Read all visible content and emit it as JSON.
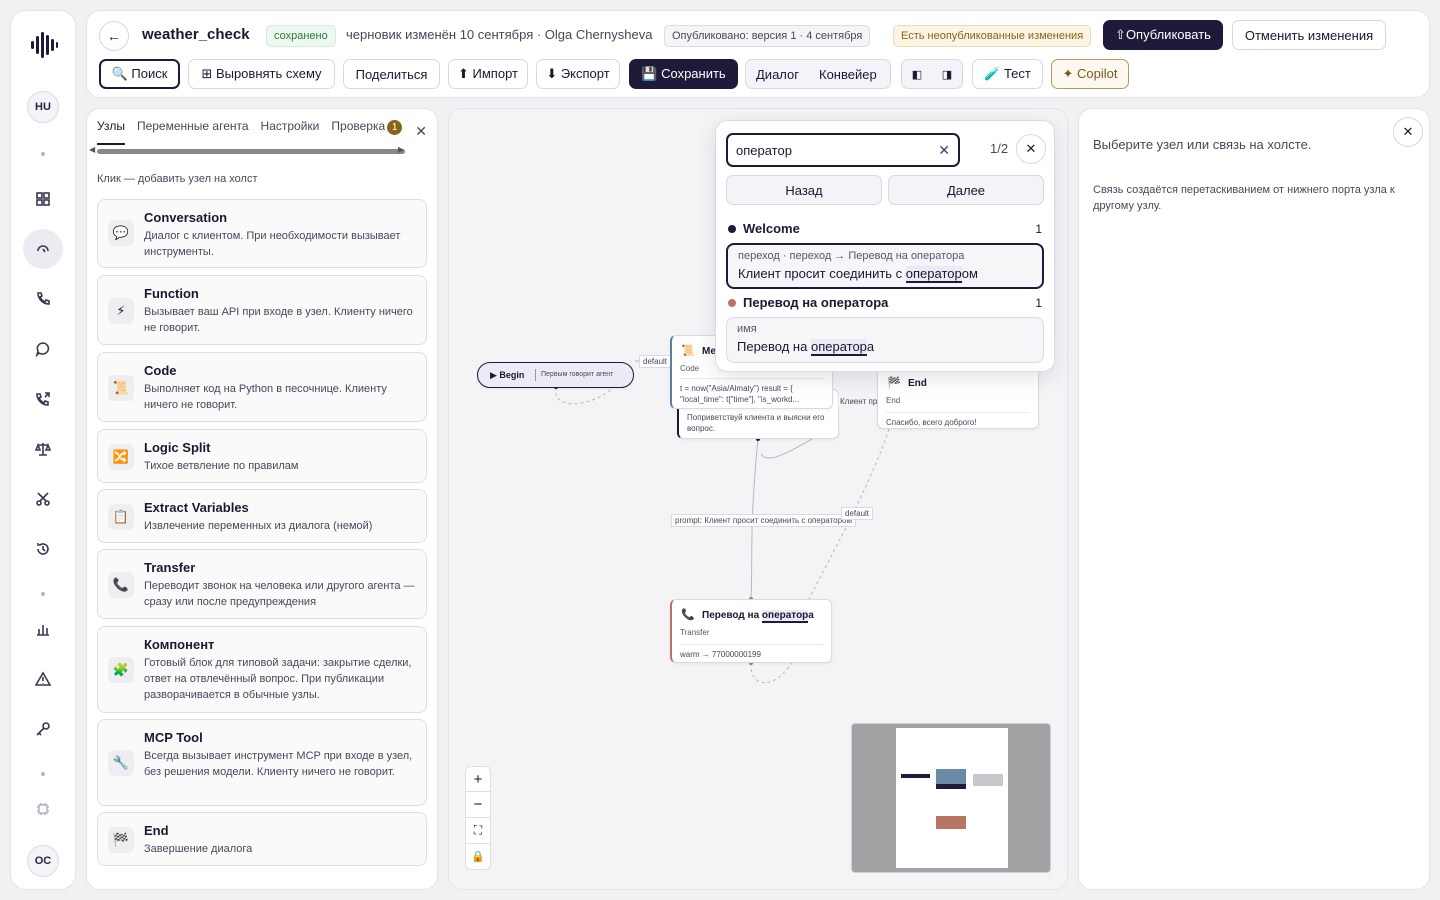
{
  "rail": {
    "avatar_top": "HU",
    "avatar_bottom": "OC"
  },
  "header": {
    "back": "←",
    "title": "weather_check",
    "saved": "сохранено",
    "draft": "черновик изменён 10 сентября · Olga Chernysheva",
    "published": "Опубликовано: версия 1 · 4 сентября",
    "unpublished": "Есть неопубликованные изменения",
    "publish": "⇧Опубликовать",
    "revert": "Отменить изменения",
    "search": "🔍 Поиск",
    "align": "⊞ Выровнять схему",
    "share": "Поделиться",
    "import": "⬆ Импорт",
    "export": "⬇ Экспорт",
    "save": "💾 Сохранить",
    "mode_dialog": "Диалог",
    "mode_pipeline": "Конвейер",
    "test": "🧪 Тест",
    "copilot": "✦ Copilot"
  },
  "left": {
    "tabs": [
      "Узлы",
      "Переменные агента",
      "Настройки",
      "Проверка"
    ],
    "check_badge": "1",
    "close": "✕",
    "hint": "Клик — добавить узел на холст",
    "cards": [
      {
        "icon": "💬",
        "name": "Conversation",
        "desc": "Диалог с клиентом. При необходимости вызывает инструменты."
      },
      {
        "icon": "⚡",
        "name": "Function",
        "desc": "Вызывает ваш API при входе в узел. Клиенту ничего не говорит."
      },
      {
        "icon": "📜",
        "name": "Code",
        "desc": "Выполняет код на Python в песочнице. Клиенту ничего не говорит."
      },
      {
        "icon": "🔀",
        "name": "Logic Split",
        "desc": "Тихое ветвление по правилам"
      },
      {
        "icon": "📋",
        "name": "Extract Variables",
        "desc": "Извлечение переменных из диалога (немой)"
      },
      {
        "icon": "📞",
        "name": "Transfer",
        "desc": "Переводит звонок на человека или другого агента — сразу или после предупреждения"
      },
      {
        "icon": "🧩",
        "name": "Компонент",
        "desc": "Готовый блок для типовой задачи: закрытие сделки, ответ на отвлечённый вопрос. При публикации разворачивается в обычные узлы."
      },
      {
        "icon": "🔧",
        "name": "MCP Tool",
        "desc": "Всегда вызывает инструмент MCP при входе в узел, без решения модели. Клиенту ничего не говорит."
      },
      {
        "icon": "🏁",
        "name": "End",
        "desc": "Завершение диалога"
      }
    ]
  },
  "canvas": {
    "begin_label": "▶ Begin",
    "begin_sub": "Первым говорит агент",
    "edge_default_1": "default",
    "edge_default_2": "default",
    "edge_prompt": "prompt: Клиент просит соединить с оператором",
    "edge_client": "Клиент пр",
    "code_title": "Me",
    "code_type": "Code",
    "code_body": "t = now(\"Asia/Almaty\") result = { \"local_time\": t[\"time\"], \"is_workd...",
    "welcome_body": "Поприветствуй клиента и выясни его вопрос.",
    "end_title": "End",
    "end_type": "End",
    "end_body": "Спасибо, всего доброго!",
    "transfer_title_a": "Перевод на ",
    "transfer_title_hl": "оператор",
    "transfer_title_b": "а",
    "transfer_type": "Transfer",
    "transfer_body": "warm → 77000000199",
    "zoom_in": "+",
    "zoom_out": "−",
    "fit": "⛶",
    "lock": "🔒"
  },
  "search": {
    "query": "оператор",
    "clear": "✕",
    "count": "1/2",
    "close": "✕",
    "prev": "Назад",
    "next": "Далее",
    "group1": {
      "name": "Welcome",
      "count": "1",
      "color": "#1e1a3a"
    },
    "result1": {
      "sub": "переход · переход → Перевод на оператора",
      "pre": "Клиент просит соединить с ",
      "hl": "оператор",
      "post": "ом"
    },
    "group2": {
      "name": "Перевод на оператора",
      "count": "1",
      "color": "#b87565"
    },
    "result2": {
      "sub": "имя",
      "pre": "Перевод на ",
      "hl": "оператор",
      "post": "а"
    }
  },
  "right": {
    "close": "✕",
    "line1": "Выберите узел или связь на холсте.",
    "line2": "Связь создаётся перетаскиванием от нижнего порта узла к другому узлу."
  }
}
